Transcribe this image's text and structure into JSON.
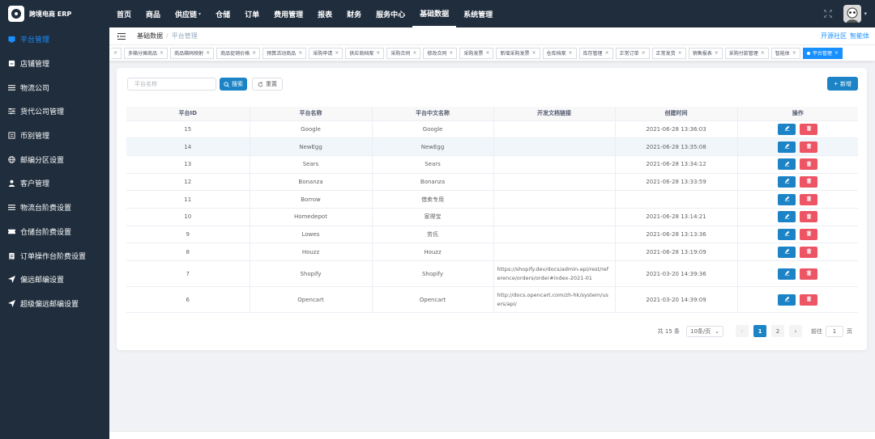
{
  "app": {
    "title": "跨境电商 ERP"
  },
  "topnav": [
    {
      "label": "首页",
      "caret": ""
    },
    {
      "label": "商品",
      "caret": ""
    },
    {
      "label": "供应链",
      "caret": "▾"
    },
    {
      "label": "仓储",
      "caret": ""
    },
    {
      "label": "订单",
      "caret": ""
    },
    {
      "label": "费用管理",
      "caret": ""
    },
    {
      "label": "报表",
      "caret": ""
    },
    {
      "label": "财务",
      "caret": ""
    },
    {
      "label": "服务中心",
      "caret": ""
    },
    {
      "label": "基础数据",
      "caret": ""
    },
    {
      "label": "系统管理",
      "caret": ""
    }
  ],
  "topnav_active": 9,
  "sidebar": [
    {
      "label": "平台管理",
      "icon": "platform-icon"
    },
    {
      "label": "店铺管理",
      "icon": "shop-icon"
    },
    {
      "label": "物流公司",
      "icon": "list-icon"
    },
    {
      "label": "货代公司管理",
      "icon": "sliders-icon"
    },
    {
      "label": "币别管理",
      "icon": "document-icon"
    },
    {
      "label": "邮编分区设置",
      "icon": "globe-icon"
    },
    {
      "label": "客户管理",
      "icon": "user-icon"
    },
    {
      "label": "物流台阶费设置",
      "icon": "list-icon"
    },
    {
      "label": "仓储台阶费设置",
      "icon": "ticket-icon"
    },
    {
      "label": "订单操作台阶费设置",
      "icon": "clipboard-icon"
    },
    {
      "label": "偏远邮编设置",
      "icon": "send-icon"
    },
    {
      "label": "超级偏远邮编设置",
      "icon": "send-icon"
    }
  ],
  "sidebar_active": 0,
  "breadcrumb": {
    "root": "基础数据",
    "sep": "/",
    "current": "平台管理"
  },
  "header_links": {
    "open_source": "开源社区",
    "brand": "智能体"
  },
  "tags": [
    "多箱分摊商品",
    "商品箱码映射",
    "商品促销价格",
    "预算活动商品",
    "采购申请",
    "供应商档案",
    "采购合同",
    "修改合同",
    "采购发票",
    "新增采购发票",
    "仓库档案",
    "库存管理",
    "正常订单",
    "正常发货",
    "销售报表",
    "采购付款管理",
    "智能体",
    "平台管理"
  ],
  "filters": {
    "name_placeholder": "平台名称",
    "search_label": "搜索",
    "reset_label": "重置",
    "add_label": "新增"
  },
  "table": {
    "headers": [
      "平台ID",
      "平台名称",
      "平台中文名称",
      "开发文档链接",
      "创建时间",
      "操作"
    ],
    "rows": [
      {
        "id": "15",
        "name": "Google",
        "cn": "Google",
        "url": "",
        "created": "2021-06-28 13:36:03"
      },
      {
        "id": "14",
        "name": "NewEgg",
        "cn": "NewEgg",
        "url": "",
        "created": "2021-06-28 13:35:08"
      },
      {
        "id": "13",
        "name": "Sears",
        "cn": "Sears",
        "url": "",
        "created": "2021-06-28 13:34:12"
      },
      {
        "id": "12",
        "name": "Bonanza",
        "cn": "Bonanza",
        "url": "",
        "created": "2021-06-28 13:33:59"
      },
      {
        "id": "11",
        "name": "Borrow",
        "cn": "借卖专用",
        "url": "",
        "created": ""
      },
      {
        "id": "10",
        "name": "Homedepot",
        "cn": "家得宝",
        "url": "",
        "created": "2021-06-28 13:14:21"
      },
      {
        "id": "9",
        "name": "Lowes",
        "cn": "劳氏",
        "url": "",
        "created": "2021-06-28 13:13:36"
      },
      {
        "id": "8",
        "name": "Houzz",
        "cn": "Houzz",
        "url": "",
        "created": "2021-06-28 13:19:09"
      },
      {
        "id": "7",
        "name": "Shopify",
        "cn": "Shopify",
        "url": "https://shopify.dev/docs/admin-api/rest/reference/orders/order#index-2021-01",
        "created": "2021-03-20 14:39:36"
      },
      {
        "id": "6",
        "name": "Opencart",
        "cn": "Opencart",
        "url": "http://docs.opencart.com/zh-hk/system/users/api/",
        "created": "2021-03-20 14:39:09"
      }
    ]
  },
  "pager": {
    "total": "共 15 条",
    "size": "10条/页",
    "prev": "‹",
    "next": "›",
    "pages": [
      "1",
      "2"
    ],
    "current": 0,
    "goto_label": "前往",
    "goto_value": "1",
    "goto_suffix": "页"
  },
  "colors": {
    "primary": "#1c84c6",
    "danger": "#ed5565",
    "nav_bg": "#1f2d3d",
    "active_link": "#1890ff"
  }
}
